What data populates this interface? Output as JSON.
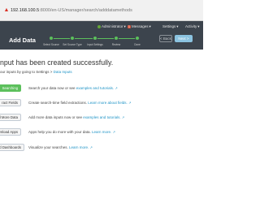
{
  "browser": {
    "warning": "Not secure",
    "url_host": "192.168.100.5",
    "url_path": ":8000/en-US/manager/search/adddatamethods"
  },
  "topnav": {
    "user_label": "Administrator",
    "messages_label": "Messages",
    "messages_count": "1",
    "settings_label": "Settings",
    "activity_label": "Activity"
  },
  "wizard": {
    "title": "Add Data",
    "steps": [
      "Select Source",
      "Set Source Type",
      "Input Settings",
      "Review",
      "Done"
    ],
    "back_label": "< Back",
    "next_label": "Next >"
  },
  "success": {
    "headline": "nput has been created successfully.",
    "subline_text": "our inputs by going to Settings > ",
    "subline_link": "Data Inputs"
  },
  "actions": [
    {
      "label": "Searching",
      "desc_before": "Search your data now or see ",
      "link": "examples and tutorials.",
      "desc_after": "",
      "primary": true
    },
    {
      "label": "ract Fields",
      "desc_before": "Create search-time field extractions. ",
      "link": "Learn more about fields.",
      "desc_after": "",
      "primary": false
    },
    {
      "label": "d More Data",
      "desc_before": "Add more data inputs now or see ",
      "link": "examples and tutorials.",
      "desc_after": "",
      "primary": false
    },
    {
      "label": "wnload Apps",
      "desc_before": "Apps help you do more with your data. ",
      "link": "Learn more.",
      "desc_after": "",
      "primary": false
    },
    {
      "label": "d Dashboards",
      "desc_before": "Visualize your searches. ",
      "link": "Learn more.",
      "desc_after": "",
      "primary": false
    }
  ]
}
